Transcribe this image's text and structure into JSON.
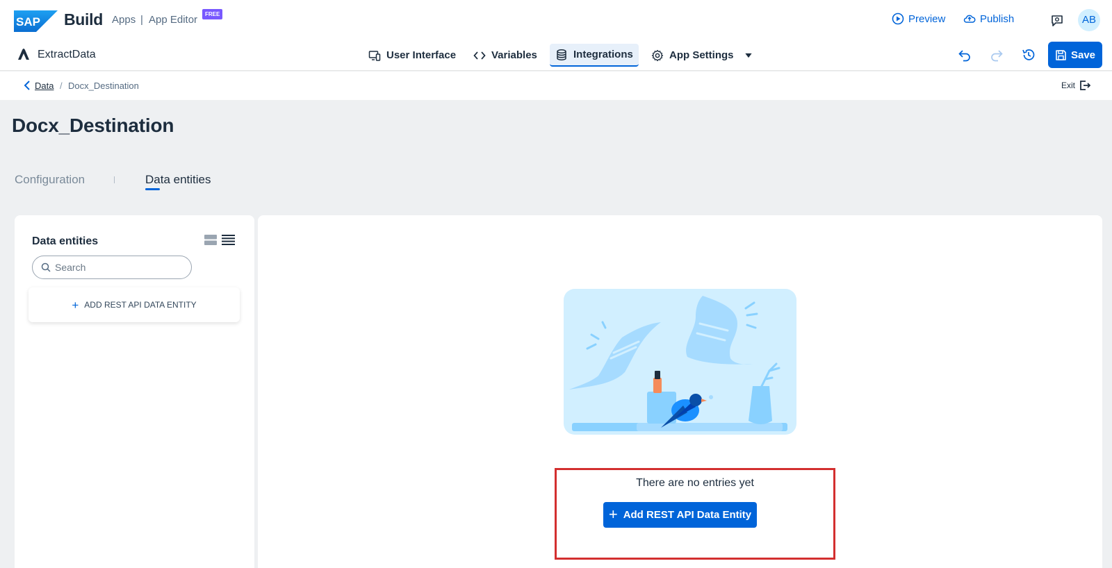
{
  "shell": {
    "logo_text": "SAP",
    "build": "Build",
    "apps": "Apps",
    "separator": "|",
    "app_editor": "App Editor",
    "badge": "FREE",
    "preview": "Preview",
    "publish": "Publish",
    "avatar_initials": "AB"
  },
  "toolbar": {
    "app_name": "ExtractData",
    "tabs": [
      {
        "label": "User Interface",
        "icon": "device-icon"
      },
      {
        "label": "Variables",
        "icon": "code-icon"
      },
      {
        "label": "Integrations",
        "icon": "database-icon",
        "active": true
      },
      {
        "label": "App Settings",
        "icon": "gear-icon"
      }
    ],
    "save": "Save"
  },
  "breadcrumb": {
    "parent": "Data",
    "separator": "/",
    "current": "Docx_Destination",
    "exit": "Exit"
  },
  "page": {
    "title": "Docx_Destination",
    "tabs": {
      "configuration": "Configuration",
      "data_entities": "Data entities"
    }
  },
  "left_panel": {
    "title": "Data entities",
    "search_placeholder": "Search",
    "add_entity": "ADD REST API DATA ENTITY"
  },
  "main_panel": {
    "empty_message": "There are no entries yet",
    "add_button": "Add REST API Data Entity"
  },
  "colors": {
    "accent": "#0064d9",
    "badge": "#7858ff",
    "highlight_border": "#d32f2f",
    "page_background": "#eef0f2"
  }
}
